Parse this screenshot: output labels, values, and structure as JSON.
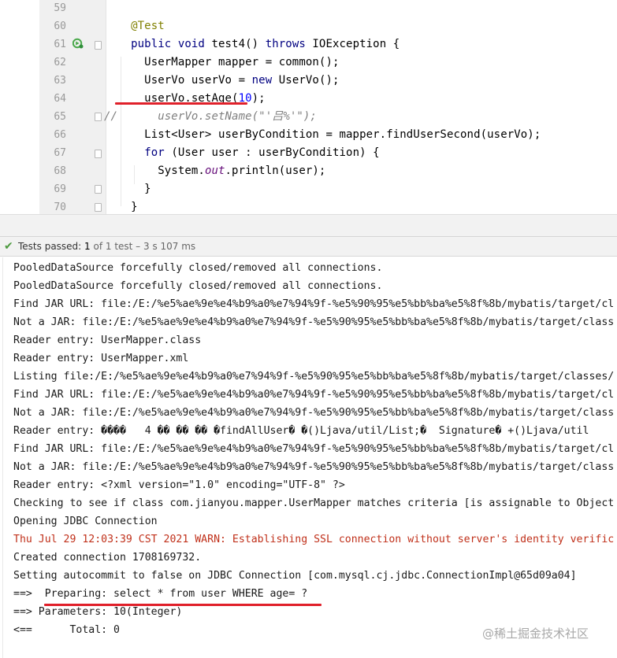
{
  "editor": {
    "lines": [
      {
        "num": "59",
        "tokens": []
      },
      {
        "num": "60",
        "tokens": [
          [
            "ann",
            "    @Test"
          ]
        ]
      },
      {
        "num": "61",
        "tokens": [
          [
            "kw",
            "    public void "
          ],
          [
            "plain",
            "test4() "
          ],
          [
            "kw",
            "throws "
          ],
          [
            "plain",
            "IOException {"
          ]
        ]
      },
      {
        "num": "62",
        "tokens": [
          [
            "plain",
            "      UserMapper mapper = common();"
          ]
        ]
      },
      {
        "num": "63",
        "tokens": [
          [
            "plain",
            "      UserVo userVo = "
          ],
          [
            "kw",
            "new "
          ],
          [
            "plain",
            "UserVo();"
          ]
        ]
      },
      {
        "num": "64",
        "tokens": [
          [
            "plain",
            "      userVo.setAge("
          ],
          [
            "num",
            "10"
          ],
          [
            "plain",
            ");"
          ]
        ]
      },
      {
        "num": "65",
        "tokens": [
          [
            "comment",
            "//      userVo.setName(\"'吕%'\");"
          ]
        ]
      },
      {
        "num": "66",
        "tokens": [
          [
            "plain",
            "      List<User> userByCondition = mapper.findUserSecond(userVo);"
          ]
        ]
      },
      {
        "num": "67",
        "tokens": [
          [
            "plain",
            "      "
          ],
          [
            "kw",
            "for "
          ],
          [
            "plain",
            "(User user : userByCondition) {"
          ]
        ]
      },
      {
        "num": "68",
        "tokens": [
          [
            "plain",
            "        System."
          ],
          [
            "field",
            "out"
          ],
          [
            "plain",
            ".println(user);"
          ]
        ]
      },
      {
        "num": "69",
        "tokens": [
          [
            "plain",
            "      }"
          ]
        ]
      },
      {
        "num": "70",
        "tokens": [
          [
            "plain",
            "    }"
          ]
        ]
      }
    ]
  },
  "status": {
    "icon": "check-icon",
    "passed_label": "Tests passed: ",
    "passed_count": "1",
    "rest": " of 1 test – 3 s 107 ms"
  },
  "console": {
    "lines": [
      {
        "text": "PooledDataSource forcefully closed/removed all connections.",
        "warn": false
      },
      {
        "text": "PooledDataSource forcefully closed/removed all connections.",
        "warn": false
      },
      {
        "text": "Find JAR URL: file:/E:/%e5%ae%9e%e4%b9%a0%e7%94%9f-%e5%90%95%e5%bb%ba%e5%8f%8b/mybatis/target/cl",
        "warn": false
      },
      {
        "text": "Not a JAR: file:/E:/%e5%ae%9e%e4%b9%a0%e7%94%9f-%e5%90%95%e5%bb%ba%e5%8f%8b/mybatis/target/class",
        "warn": false
      },
      {
        "text": "Reader entry: UserMapper.class",
        "warn": false
      },
      {
        "text": "Reader entry: UserMapper.xml",
        "warn": false
      },
      {
        "text": "Listing file:/E:/%e5%ae%9e%e4%b9%a0%e7%94%9f-%e5%90%95%e5%bb%ba%e5%8f%8b/mybatis/target/classes/",
        "warn": false
      },
      {
        "text": "Find JAR URL: file:/E:/%e5%ae%9e%e4%b9%a0%e7%94%9f-%e5%90%95%e5%bb%ba%e5%8f%8b/mybatis/target/cl",
        "warn": false
      },
      {
        "text": "Not a JAR: file:/E:/%e5%ae%9e%e4%b9%a0%e7%94%9f-%e5%90%95%e5%bb%ba%e5%8f%8b/mybatis/target/class",
        "warn": false
      },
      {
        "text": "Reader entry: ����   4 �� �� �� �findAllUser� �()Ljava/util/List;�  Signature� +()Ljava/util",
        "warn": false
      },
      {
        "text": "Find JAR URL: file:/E:/%e5%ae%9e%e4%b9%a0%e7%94%9f-%e5%90%95%e5%bb%ba%e5%8f%8b/mybatis/target/cl",
        "warn": false
      },
      {
        "text": "Not a JAR: file:/E:/%e5%ae%9e%e4%b9%a0%e7%94%9f-%e5%90%95%e5%bb%ba%e5%8f%8b/mybatis/target/class",
        "warn": false
      },
      {
        "text": "Reader entry: <?xml version=\"1.0\" encoding=\"UTF-8\" ?>",
        "warn": false
      },
      {
        "text": "Checking to see if class com.jianyou.mapper.UserMapper matches criteria [is assignable to Object",
        "warn": false
      },
      {
        "text": "Opening JDBC Connection",
        "warn": false
      },
      {
        "text": "Thu Jul 29 12:03:39 CST 2021 WARN: Establishing SSL connection without server's identity verific",
        "warn": true
      },
      {
        "text": "Created connection 1708169732.",
        "warn": false
      },
      {
        "text": "Setting autocommit to false on JDBC Connection [com.mysql.cj.jdbc.ConnectionImpl@65d09a04]",
        "warn": false
      },
      {
        "text": "==>  Preparing: select * from user WHERE age= ?",
        "warn": false
      },
      {
        "text": "==> Parameters: 10(Integer)",
        "warn": false
      },
      {
        "text": "<==      Total: 0",
        "warn": false
      }
    ]
  },
  "watermark": {
    "text": "@稀土掘金技术社区"
  }
}
